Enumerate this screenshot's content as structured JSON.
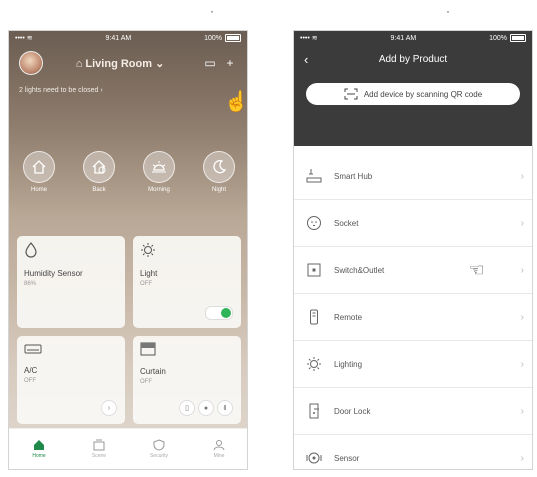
{
  "left": {
    "status": {
      "time": "9:41 AM",
      "battery": "100%"
    },
    "room_title": "Living Room",
    "notice": "2 lights need to be closed",
    "scenes": [
      {
        "label": "Home",
        "icon": "home-icon"
      },
      {
        "label": "Back",
        "icon": "back-home-icon"
      },
      {
        "label": "Morning",
        "icon": "sunrise-icon"
      },
      {
        "label": "Night",
        "icon": "moon-icon"
      }
    ],
    "cards": {
      "humidity": {
        "title": "Humidity Sensor",
        "status": "86%"
      },
      "light": {
        "title": "Light",
        "status": "OFF"
      },
      "ac": {
        "title": "A/C",
        "status": "OFF"
      },
      "curtain": {
        "title": "Curtain",
        "status": "OFF"
      }
    },
    "tabs": [
      {
        "label": "Home",
        "icon": "home-icon"
      },
      {
        "label": "Scene",
        "icon": "scene-icon"
      },
      {
        "label": "Security",
        "icon": "shield-icon"
      },
      {
        "label": "Mine",
        "icon": "user-icon"
      }
    ]
  },
  "right": {
    "status": {
      "time": "9:41 AM",
      "battery": "100%"
    },
    "title": "Add by Product",
    "scan_label": "Add device by scanning QR code",
    "products": [
      {
        "label": "Smart Hub",
        "icon": "hub-icon"
      },
      {
        "label": "Socket",
        "icon": "socket-icon"
      },
      {
        "label": "Switch&Outlet",
        "icon": "switch-icon"
      },
      {
        "label": "Remote",
        "icon": "remote-icon"
      },
      {
        "label": "Lighting",
        "icon": "bulb-icon"
      },
      {
        "label": "Door Lock",
        "icon": "lock-icon"
      },
      {
        "label": "Sensor",
        "icon": "sensor-icon"
      }
    ]
  },
  "colors": {
    "accent_green": "#2fb45a",
    "header_dark": "#3b3b3b"
  }
}
